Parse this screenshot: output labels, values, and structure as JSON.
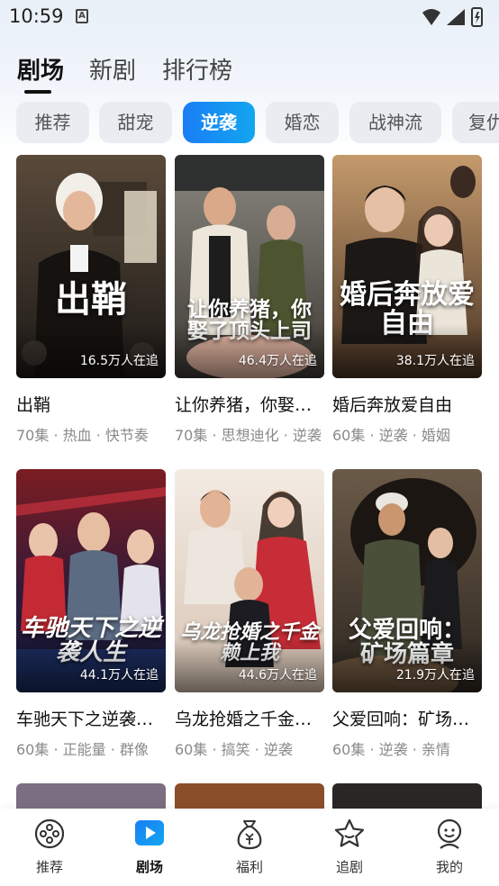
{
  "status_bar": {
    "time": "10:59",
    "notification_icon": "A"
  },
  "main_tabs": [
    {
      "label": "剧场",
      "active": true
    },
    {
      "label": "新剧",
      "active": false
    },
    {
      "label": "排行榜",
      "active": false
    }
  ],
  "categories": [
    {
      "label": "推荐",
      "active": false
    },
    {
      "label": "甜宠",
      "active": false
    },
    {
      "label": "逆袭",
      "active": true
    },
    {
      "label": "婚恋",
      "active": false
    },
    {
      "label": "战神流",
      "active": false
    },
    {
      "label": "复仇",
      "active": false
    }
  ],
  "dramas": [
    {
      "poster_text": "出鞘",
      "watching": "16.5万人在追",
      "title": "出鞘",
      "meta": "70集 · 热血 · 快节奏"
    },
    {
      "poster_text": "让你养猪，你娶了顶头上司",
      "watching": "46.4万人在追",
      "title": "让你养猪，你娶了顶头上司",
      "meta": "70集 · 思想迪化 · 逆袭"
    },
    {
      "poster_text": "婚后奔放爱自由",
      "watching": "38.1万人在追",
      "title": "婚后奔放爱自由",
      "meta": "60集 · 逆袭 · 婚姻"
    },
    {
      "poster_text": "车驰天下之逆袭人生",
      "watching": "44.1万人在追",
      "title": "车驰天下之逆袭人生",
      "meta": "60集 · 正能量 · 群像"
    },
    {
      "poster_text": "乌龙抢婚之千金赖上我",
      "watching": "44.6万人在追",
      "title": "乌龙抢婚之千金赖上我",
      "meta": "60集 · 搞笑 · 逆袭"
    },
    {
      "poster_text": "父爱回响：矿场篇章",
      "watching": "21.9万人在追",
      "title": "父爱回响：矿场篇章",
      "meta": "60集 · 逆袭 · 亲情"
    }
  ],
  "bottom_nav": [
    {
      "label": "推荐",
      "icon": "film-reel-icon",
      "active": false
    },
    {
      "label": "剧场",
      "icon": "play-icon",
      "active": true
    },
    {
      "label": "福利",
      "icon": "money-bag-icon",
      "active": false
    },
    {
      "label": "追剧",
      "icon": "star-icon",
      "active": false
    },
    {
      "label": "我的",
      "icon": "user-icon",
      "active": false
    }
  ],
  "colors": {
    "accent_start": "#1a7ef5",
    "accent_end": "#13a6f0",
    "chip_bg": "#e9edf1",
    "meta_gray": "#8a8a8a"
  }
}
